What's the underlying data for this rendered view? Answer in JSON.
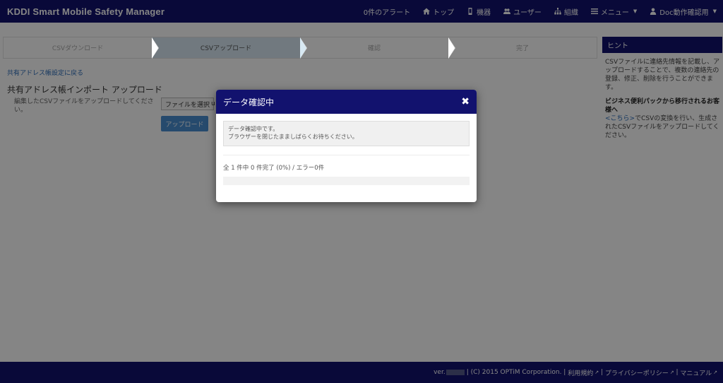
{
  "app": {
    "title": "KDDI Smart Mobile Safety Manager"
  },
  "nav": {
    "alerts": "0件のアラート",
    "top": "トップ",
    "devices": "機器",
    "users": "ユーザー",
    "org": "組織",
    "menu": "メニュー",
    "account": "Doc動作確認用"
  },
  "wizard": {
    "steps": [
      "CSVダウンロード",
      "CSVアップロード",
      "確認",
      "完了"
    ],
    "active_index": 1
  },
  "page": {
    "back_link": "共有アドレス帳設定に戻る",
    "title": "共有アドレス帳インポート アップロード",
    "description": "編集したCSVファイルをアップロードしてください。",
    "file_button": "ファイルを選択",
    "file_name": "u",
    "upload_button": "アップロード"
  },
  "hint": {
    "heading": "ヒント",
    "body": "CSVファイルに連絡先情報を記載し、アップロードすることで、複数の連絡先の登録、修正、削除を行うことができます。",
    "subheading": "ビジネス便利パックから移行されるお客様へ",
    "link_text": "<こちら>",
    "body2": "でCSVの変換を行い、生成されたCSVファイルをアップロードしてください。"
  },
  "footer": {
    "ver_label": "ver.",
    "copyright": "| (C) 2015 OPTiM Corporation. |",
    "terms": "利用規約",
    "privacy": "プライバシーポリシー",
    "manual": "マニュアル",
    "sep": "|"
  },
  "modal": {
    "title": "データ確認中",
    "close_glyph": "✖",
    "message_line1": "データ確認中です。",
    "message_line2": "ブラウザーを閉じたまましばらくお待ちください。",
    "progress_text": "全 1 件中 0 件完了 (0%) / エラー0件",
    "progress_fraction": 0
  },
  "colors": {
    "navy": "#12126e",
    "accent": "#4a8fd1",
    "link": "#2a6bb8"
  }
}
